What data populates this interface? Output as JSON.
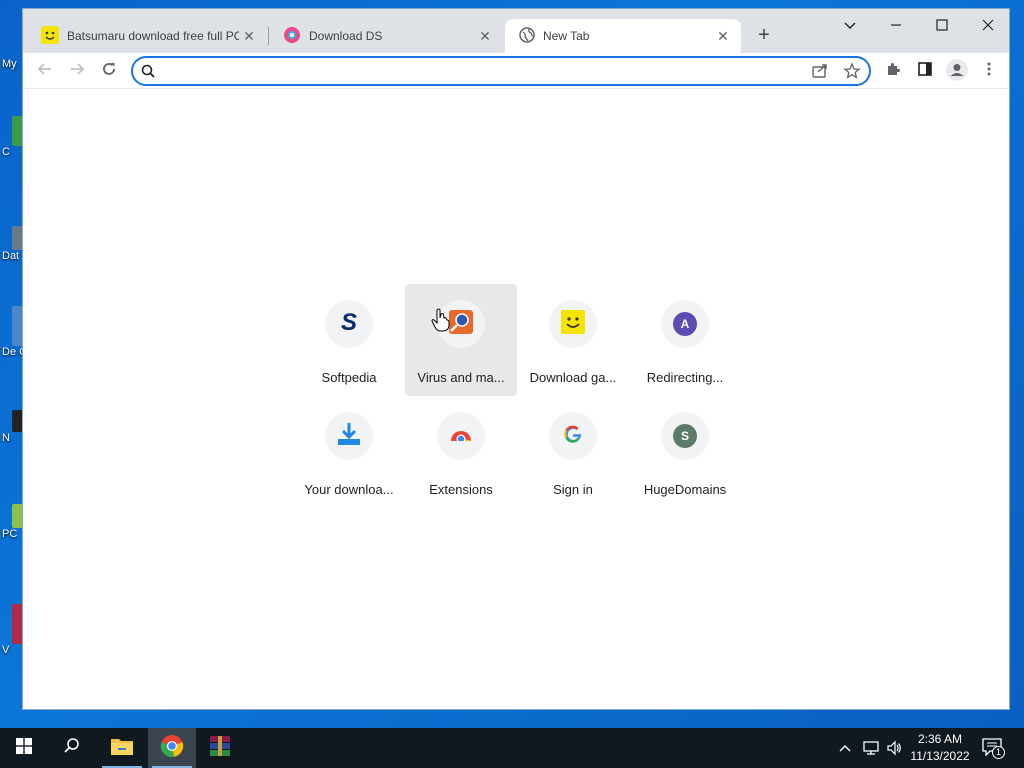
{
  "desktop": {
    "icons": [
      {
        "label": "My"
      },
      {
        "label": "C"
      },
      {
        "label": "Dat"
      },
      {
        "label": "De Ca"
      },
      {
        "label": "N"
      },
      {
        "label": "PC"
      },
      {
        "label": "V"
      }
    ]
  },
  "tabs": [
    {
      "title": "Batsumaru download free full PC",
      "favicon": "smiley-icon",
      "active": false
    },
    {
      "title": "Download DS",
      "favicon": "ds-logo-icon",
      "active": false
    },
    {
      "title": "New Tab",
      "favicon": "globe-icon",
      "active": true
    }
  ],
  "new_tab_label": "+",
  "omnibox": {
    "value": "",
    "placeholder": ""
  },
  "shortcuts": [
    {
      "label": "Softpedia",
      "icon": "softpedia-s-icon"
    },
    {
      "label": "Virus and ma...",
      "icon": "virus-scan-icon"
    },
    {
      "label": "Download ga...",
      "icon": "smiley-icon"
    },
    {
      "label": "Redirecting...",
      "icon": "letter-a-icon",
      "letter": "A",
      "color": "#5e4bb3"
    },
    {
      "label": "Your downloa...",
      "icon": "download-icon"
    },
    {
      "label": "Extensions",
      "icon": "chrome-icon"
    },
    {
      "label": "Sign in",
      "icon": "google-g-icon"
    },
    {
      "label": "HugeDomains",
      "icon": "letter-s-icon",
      "letter": "S",
      "color": "#5b7a6a"
    }
  ],
  "taskbar": {
    "clock_time": "2:36 AM",
    "clock_date": "11/13/2022",
    "notification_count": "1"
  },
  "colors": {
    "accent": "#1a73e8",
    "tabstrip": "#dee1e6",
    "desktop": "#0b6fd1",
    "taskbar": "#101820"
  }
}
